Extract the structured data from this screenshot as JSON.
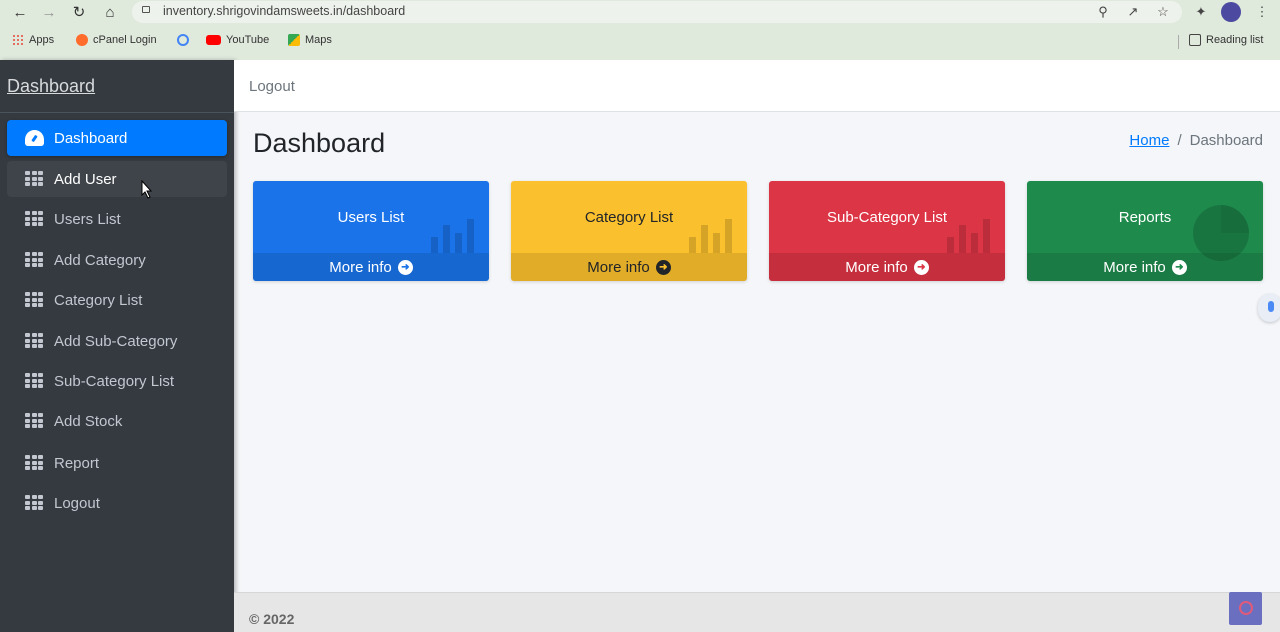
{
  "browser": {
    "url": "inventory.shrigovindamsweets.in/dashboard",
    "bookmarks": [
      {
        "label": "Apps",
        "icon": "apps-grid-icon",
        "color": "#e94235"
      },
      {
        "label": "cPanel Login",
        "icon": "cpanel-icon",
        "color": "#ff6c2c"
      },
      {
        "label": "",
        "icon": "google-icon",
        "color": "#4285f4"
      },
      {
        "label": "YouTube",
        "icon": "youtube-icon",
        "color": "#ff0000"
      },
      {
        "label": "Maps",
        "icon": "maps-icon",
        "color": "#34a853"
      }
    ],
    "reading_list": "Reading list"
  },
  "sidebar": {
    "brand": "Dashboard",
    "items": [
      {
        "label": "Dashboard",
        "icon": "dashboard-gauge-icon",
        "state": "active"
      },
      {
        "label": "Add User",
        "icon": "grid-icon",
        "state": "hover"
      },
      {
        "label": "Users List",
        "icon": "grid-icon",
        "state": ""
      },
      {
        "label": "Add Category",
        "icon": "grid-icon",
        "state": ""
      },
      {
        "label": "Category List",
        "icon": "grid-icon",
        "state": ""
      },
      {
        "label": "Add Sub-Category",
        "icon": "grid-icon",
        "state": ""
      },
      {
        "label": "Sub-Category List",
        "icon": "grid-icon",
        "state": ""
      },
      {
        "label": "Add Stock",
        "icon": "grid-icon",
        "state": ""
      },
      {
        "label": "Report",
        "icon": "grid-icon",
        "state": ""
      },
      {
        "label": "Logout",
        "icon": "grid-icon",
        "state": ""
      }
    ]
  },
  "topbar": {
    "logout": "Logout"
  },
  "main": {
    "title": "Dashboard",
    "breadcrumb": {
      "home": "Home",
      "separator": "/",
      "current": "Dashboard"
    },
    "boxes": [
      {
        "title": "Users List",
        "footer": "More info",
        "color": "#1a73e8",
        "text_color": "#ffffff",
        "icon": "bar-chart-icon"
      },
      {
        "title": "Category List",
        "footer": "More info",
        "color": "#fbc02d",
        "text_color": "#212529",
        "icon": "bar-chart-icon"
      },
      {
        "title": "Sub-Category List",
        "footer": "More info",
        "color": "#dc3545",
        "text_color": "#ffffff",
        "icon": "bar-chart-icon"
      },
      {
        "title": "Reports",
        "footer": "More info",
        "color": "#1e8a4c",
        "text_color": "#ffffff",
        "icon": "pie-chart-icon"
      }
    ]
  },
  "footer": {
    "copyright": "© 2022"
  }
}
